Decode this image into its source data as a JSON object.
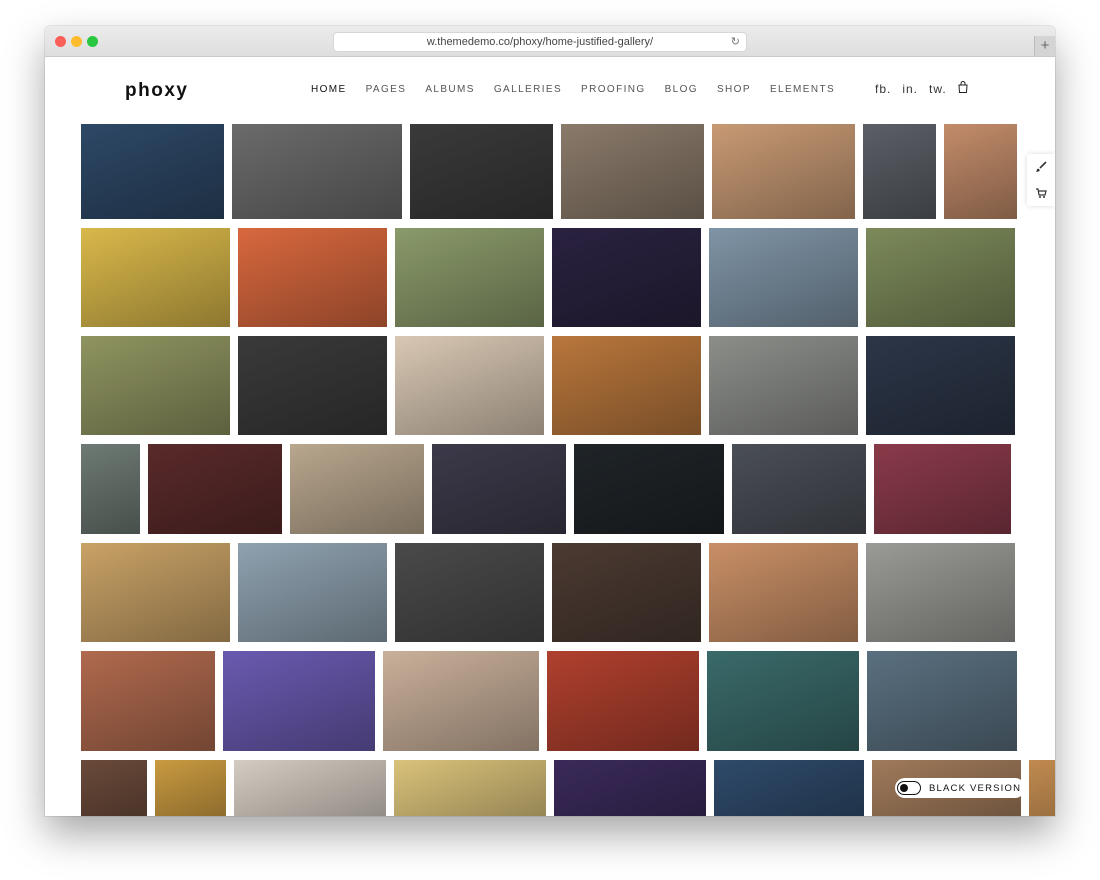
{
  "browser": {
    "url": "w.themedemo.co/phoxy/home-justified-gallery/",
    "new_tab": "+"
  },
  "site": {
    "logo": "phoxy",
    "nav": [
      {
        "label": "HOME",
        "active": true
      },
      {
        "label": "PAGES"
      },
      {
        "label": "ALBUMS"
      },
      {
        "label": "GALLERIES"
      },
      {
        "label": "PROOFING"
      },
      {
        "label": "BLOG"
      },
      {
        "label": "SHOP"
      },
      {
        "label": "ELEMENTS"
      }
    ],
    "social": [
      "fb.",
      "in.",
      "tw."
    ],
    "cart_icon": "shopping-bag-icon"
  },
  "side_tools": [
    "paintbrush-icon",
    "cart-icon"
  ],
  "black_version_label": "BLACK VERSION",
  "gallery": {
    "rows": [
      [
        "#2d4866",
        "#6b6b6b",
        "#3a3a3a",
        "#8a7a6a",
        "#c89a74",
        "#5b5f66",
        "#c38c6a"
      ],
      [
        "#d9b84a",
        "#d8683e",
        "#8a9a6a",
        "#2a2240",
        "#7f94a6",
        "#7c8a5a"
      ],
      [
        "#8f9460",
        "#3a3a3a",
        "#d8c7b3",
        "#b9773c",
        "#8c8e8a",
        "#2c3648"
      ],
      [
        "#6e7a74",
        "#5a2a2a",
        "#b9a78e",
        "#3c3a4a",
        "#1f2428",
        "#4a4e56",
        "#8a3a4a"
      ],
      [
        "#c9a266",
        "#8fa2b0",
        "#4a4a4a",
        "#4b3a32",
        "#c98f66",
        "#9a9a96"
      ],
      [
        "#b06a4e",
        "#6a5ab0",
        "#c9b09a",
        "#b0402e",
        "#3a6a6a",
        "#5a7080"
      ],
      [
        "#6a4a3a",
        "#c99a40",
        "#d4ccc2",
        "#d9c27a",
        "#3a2a5a",
        "#2e4a6a",
        "#a07a5a",
        "#c08a50"
      ]
    ]
  }
}
